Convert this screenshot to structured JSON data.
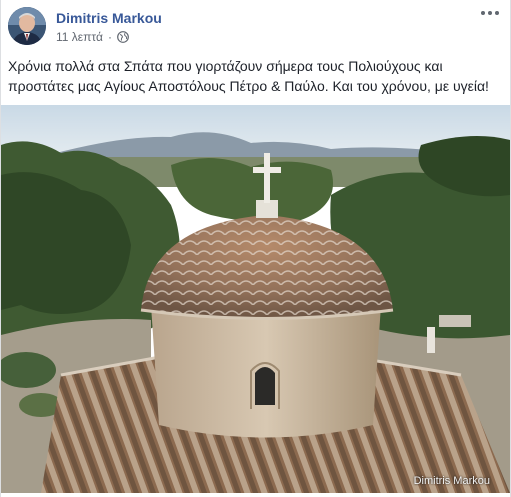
{
  "post": {
    "author": "Dimitris Markou",
    "time": "11 λεπτά",
    "separator": "·",
    "privacy_icon": "globe-icon",
    "more_icon": "more-options-icon",
    "text": "Χρόνια πολλά στα Σπάτα που γιορτάζουν σήμερα τους Πολιούχους και προστάτες μας Αγίους Αποστόλους Πέτρο & Παύλο. Και του χρόνου, με υγεία!",
    "photo_watermark": "Dimitris Markou"
  },
  "colors": {
    "author_link": "#385898",
    "meta_text": "#616770",
    "body_text": "#1d2129"
  }
}
